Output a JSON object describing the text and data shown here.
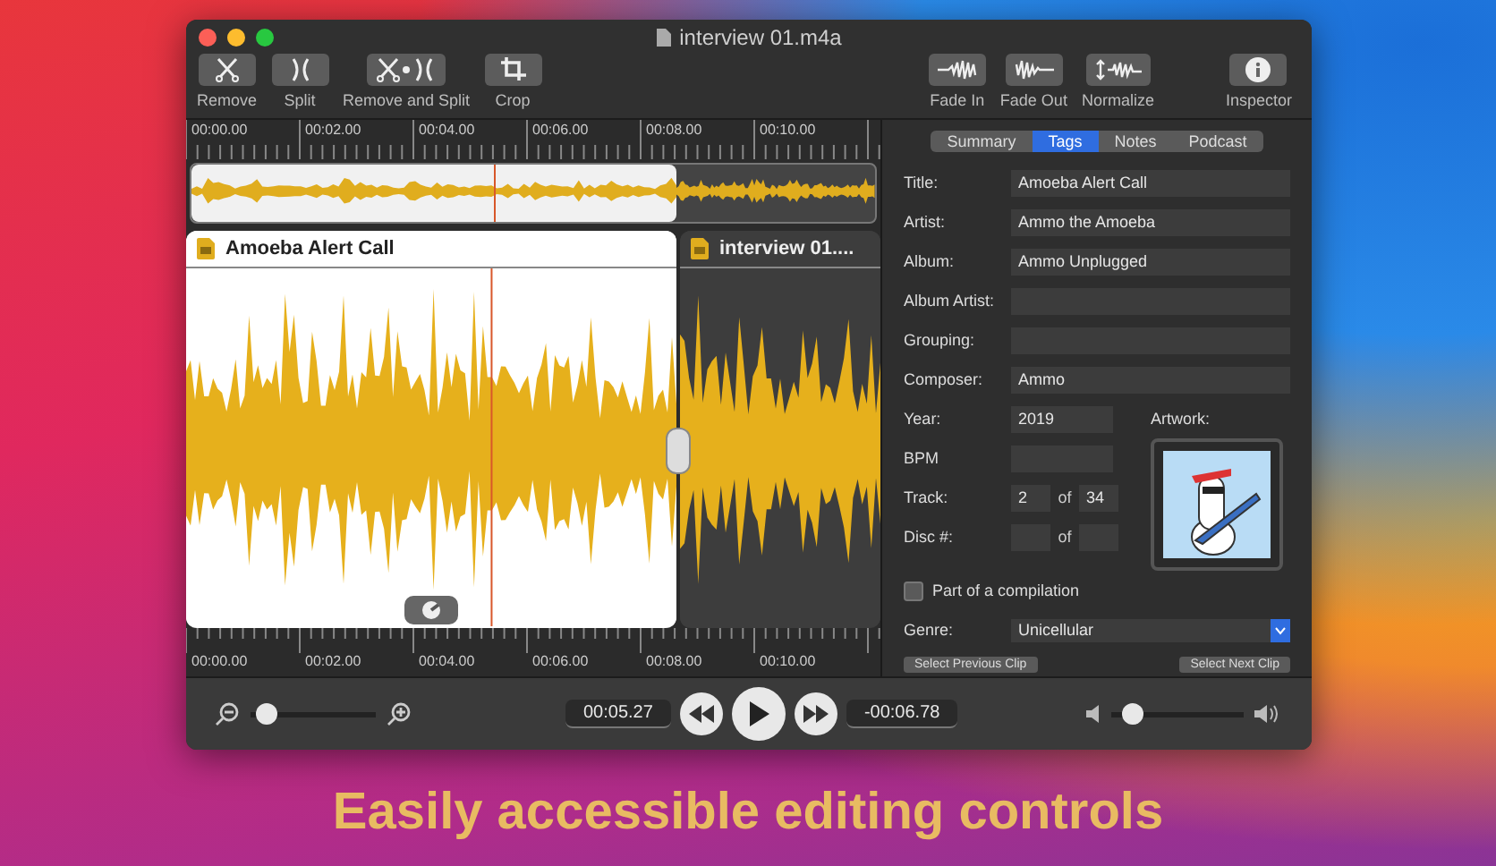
{
  "window": {
    "title": "interview 01.m4a"
  },
  "toolbar": {
    "left": [
      {
        "label": "Remove",
        "kind": "scissors"
      },
      {
        "label": "Split",
        "kind": "split"
      },
      {
        "label": "Remove and Split",
        "kind": "scissors-split"
      },
      {
        "label": "Crop",
        "kind": "crop"
      }
    ],
    "right": [
      {
        "label": "Fade In",
        "kind": "fade-in"
      },
      {
        "label": "Fade Out",
        "kind": "fade-out"
      },
      {
        "label": "Normalize",
        "kind": "normalize"
      },
      {
        "label": "Inspector",
        "kind": "info"
      }
    ]
  },
  "timeline": {
    "top_ruler": [
      "00:00.00",
      "00:02.00",
      "00:04.00",
      "00:06.00",
      "00:08.00",
      "00:10.00"
    ],
    "playhead": {
      "level": 0.44
    },
    "clips": [
      {
        "title": "Amoeba Alert Call",
        "selected": true
      },
      {
        "title": "interview 01....",
        "selected": false
      }
    ],
    "bottom_ruler": [
      "00:00.00",
      "00:02.00",
      "00:04.00",
      "00:06.00",
      "00:08.00",
      "00:10.00"
    ]
  },
  "inspector": {
    "tabs": [
      {
        "label": "Summary",
        "selected": false
      },
      {
        "label": "Tags",
        "selected": true
      },
      {
        "label": "Notes",
        "selected": false
      },
      {
        "label": "Podcast",
        "selected": false
      }
    ],
    "fields": [
      {
        "label": "Title:",
        "value": "Amoeba Alert Call"
      },
      {
        "label": "Artist:",
        "value": "Ammo the Amoeba"
      },
      {
        "label": "Album:",
        "value": "Ammo Unplugged"
      },
      {
        "label": "Album Artist:"
      },
      {
        "label": "Grouping:"
      },
      {
        "label": "Composer:",
        "value": "Ammo"
      }
    ],
    "year": {
      "label": "Year:",
      "value": "2019"
    },
    "bpm": {
      "label": "BPM"
    },
    "track": {
      "label": "Track:",
      "value": "2",
      "of": "of",
      "total": "34"
    },
    "disc": {
      "label": "Disc #:",
      "of": "of"
    },
    "artwork": {
      "label": "Artwork:"
    },
    "compilation": {
      "label": "Part of a compilation",
      "checked": false
    },
    "genre": {
      "label": "Genre:",
      "value": "Unicellular"
    },
    "buttons": [
      "Select Previous Clip",
      "Select Next Clip"
    ]
  },
  "transport": {
    "zoom": {
      "level": 0.05
    },
    "current_time": "00:05.27",
    "remaining_time": "-00:06.78",
    "volume": {
      "level": 0.1
    }
  },
  "caption": "Easily accessible editing controls"
}
